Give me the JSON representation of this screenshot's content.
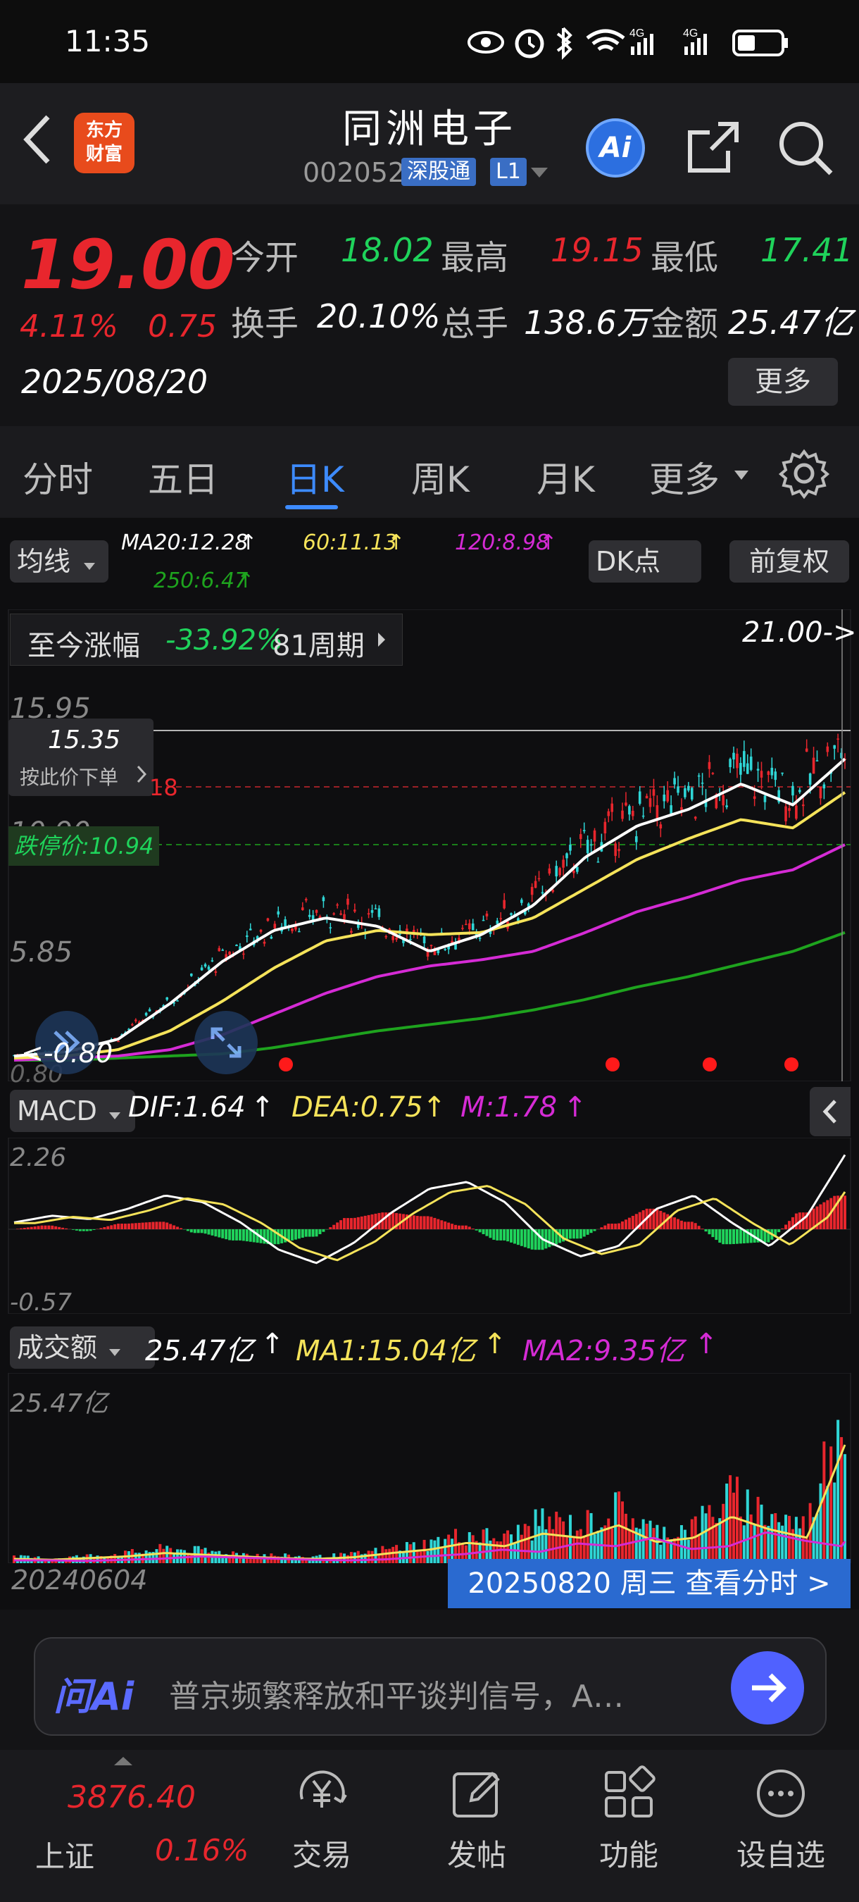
{
  "status_bar": {
    "time": "11:35",
    "icons": [
      "eye-icon",
      "alarm-icon",
      "bluetooth-icon",
      "wifi-icon",
      "signal-4g-icon",
      "signal-4g-icon",
      "battery-icon"
    ],
    "net1": "4G",
    "net2": "4G"
  },
  "header": {
    "logo_line1": "东方",
    "logo_line2": "财富",
    "title": "同洲电子",
    "code": "002052",
    "badge1": "深股通",
    "badge2": "L1",
    "ai_label": "Ai"
  },
  "quote": {
    "price": "19.00",
    "change_pct": "4.11%",
    "change": "0.75",
    "date": "2025/08/20",
    "open_label": "今开",
    "open": "18.02",
    "high_label": "最高",
    "high": "19.15",
    "low_label": "最低",
    "low": "17.41",
    "turnover_label": "换手",
    "turnover": "20.10%",
    "volume_label": "总手",
    "volume": "138.6万",
    "amount_label": "金额",
    "amount": "25.47亿",
    "more": "更多"
  },
  "tabs": [
    "分时",
    "五日",
    "日K",
    "周K",
    "月K",
    "更多"
  ],
  "active_tab": 2,
  "kline": {
    "ma_selector": "均线",
    "ma20": "MA20:12.28",
    "ma60": "60:11.13",
    "ma120": "120:8.98",
    "ma250": "250:6.47",
    "dk_btn": "DK点",
    "adjust_btn": "前复权",
    "range_label": "至今涨幅",
    "range_pct": "-33.92%",
    "range_periods": "81周期",
    "high_marker": "21.00->",
    "y_labels": [
      "15.95",
      "10.90",
      "5.85",
      "0.80"
    ],
    "crosshair_price": "15.35",
    "order_hint": "按此价下单",
    "limit_up_label": "18",
    "limit_down_label": "跌停价:10.94",
    "low_marker": "<-0.80"
  },
  "macd": {
    "selector": "MACD",
    "dif": "DIF:1.64",
    "dea": "DEA:0.75",
    "m": "M:1.78",
    "y_top": "2.26",
    "y_bottom": "-0.57"
  },
  "volume": {
    "selector": "成交额",
    "value": "25.47亿",
    "ma1": "MA1:15.04亿",
    "ma2": "MA2:9.35亿",
    "y_top": "25.47亿"
  },
  "dates": {
    "start": "20240604",
    "end_btn": "20250820 周三 查看分时 >"
  },
  "ask": {
    "brand": "问Ai",
    "prompt": "普京频繁释放和平谈判信号，A…"
  },
  "bottom_nav": {
    "index_value": "3876.40",
    "index_name": "上证",
    "index_pct": "0.16%",
    "items": [
      "交易",
      "发帖",
      "功能",
      "设自选"
    ]
  },
  "colors": {
    "up": "#e8262d",
    "down": "#1fd35b",
    "accent": "#3d8bff",
    "ma_white": "#ffffff",
    "ma_yellow": "#f5e35a",
    "ma_magenta": "#d52bd5",
    "ma_green": "#1ea31e"
  },
  "chart_data": {
    "type": "line",
    "title": "",
    "series": [
      {
        "name": "MA20",
        "values": [
          1.0,
          1.2,
          1.8,
          3.5,
          5.5,
          7.0,
          7.6,
          7.2,
          6.0,
          6.8,
          8.2,
          10.5,
          12.0,
          12.8,
          14.0,
          13.0,
          15.2
        ]
      },
      {
        "name": "60",
        "values": [
          0.9,
          1.0,
          1.3,
          2.2,
          3.6,
          5.2,
          6.5,
          7.0,
          6.8,
          6.9,
          7.6,
          9.0,
          10.4,
          11.4,
          12.3,
          11.9,
          13.6
        ]
      },
      {
        "name": "120",
        "values": [
          0.8,
          0.9,
          1.0,
          1.3,
          2.0,
          3.0,
          4.0,
          4.8,
          5.3,
          5.6,
          6.0,
          6.9,
          7.9,
          8.6,
          9.4,
          9.9,
          11.1
        ]
      },
      {
        "name": "250",
        "values": [
          0.8,
          0.8,
          0.9,
          1.0,
          1.1,
          1.4,
          1.8,
          2.2,
          2.5,
          2.8,
          3.2,
          3.7,
          4.3,
          4.8,
          5.4,
          6.0,
          6.9
        ]
      }
    ],
    "ylim": [
      0.8,
      21.0
    ]
  }
}
